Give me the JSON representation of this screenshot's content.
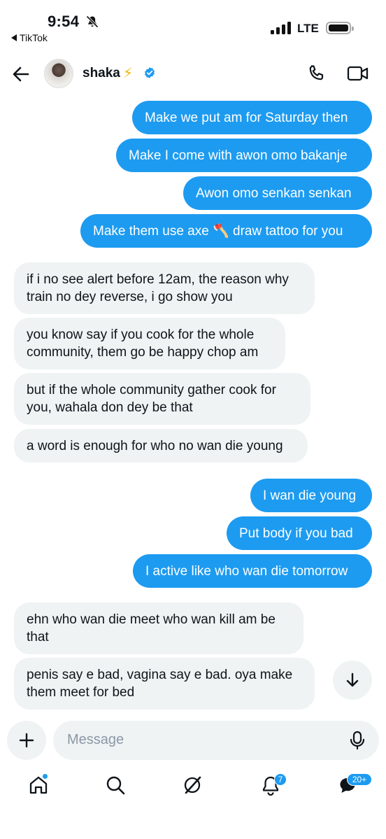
{
  "status_bar": {
    "time": "9:54",
    "back_app": "TikTok",
    "network": "LTE"
  },
  "header": {
    "name": "shaka",
    "name_emoji": "⚡"
  },
  "messages": [
    {
      "from": "me",
      "text": "Make we put am for Saturday then"
    },
    {
      "from": "me",
      "text": "Make I come with awon omo bakanje"
    },
    {
      "from": "me",
      "text": "Awon omo senkan senkan"
    },
    {
      "from": "me",
      "text": "Make them use axe 🪓 draw tattoo for you"
    },
    {
      "from": "them",
      "text": "if i no see alert before 12am, the reason why train no dey reverse, i go show you"
    },
    {
      "from": "them",
      "text": "you know say if you cook for the whole community, them go be happy chop am"
    },
    {
      "from": "them",
      "text": "but if the whole community gather cook for you, wahala don dey be that"
    },
    {
      "from": "them",
      "text": "a word is enough for who no wan die young"
    },
    {
      "from": "me",
      "text": "I wan die young"
    },
    {
      "from": "me",
      "text": "Put body if you bad"
    },
    {
      "from": "me",
      "text": "I active like who wan die tomorrow"
    },
    {
      "from": "them",
      "text": "ehn who wan die meet who wan kill am be that"
    },
    {
      "from": "them",
      "text": "penis say e bad, vagina say e bad. oya make them meet for bed"
    }
  ],
  "composer": {
    "placeholder": "Message"
  },
  "nav": {
    "notifications_badge": "7",
    "messages_badge": "20+"
  },
  "colors": {
    "accent": "#1d9bf0",
    "incoming_bubble": "#eff3f4",
    "verified": "#1d9bf0",
    "bolt": "#f5b400"
  }
}
